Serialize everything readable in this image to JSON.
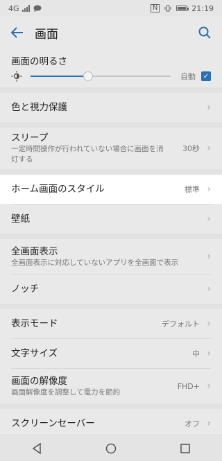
{
  "status_bar": {
    "network": "4G",
    "time": "21:19"
  },
  "app_bar": {
    "title": "画面"
  },
  "brightness": {
    "title": "画面の明るさ",
    "level": 0.41,
    "auto_label": "自動",
    "auto_checked": true
  },
  "items": [
    {
      "title": "色と視力保護",
      "sub": "",
      "value": ""
    },
    {
      "title": "スリープ",
      "sub": "一定時間操作が行われていない場合に画面を消灯する",
      "value": "30秒"
    },
    {
      "title": "ホーム画面のスタイル",
      "sub": "",
      "value": "標準"
    },
    {
      "title": "壁紙",
      "sub": "",
      "value": ""
    },
    {
      "title": "全画面表示",
      "sub": "全画面表示に対応していないアプリを全画面で表示",
      "value": ""
    },
    {
      "title": "ノッチ",
      "sub": "",
      "value": ""
    },
    {
      "title": "表示モード",
      "sub": "",
      "value": "デフォルト"
    },
    {
      "title": "文字サイズ",
      "sub": "",
      "value": "中"
    },
    {
      "title": "画面の解像度",
      "sub": "画面解像度を調整して電力を節約",
      "value": "FHD+"
    },
    {
      "title": "スクリーンセーバー",
      "sub": "",
      "value": "オフ"
    }
  ],
  "colors": {
    "accent": "#2a6fb0",
    "background": "#e9e9e9",
    "highlight": "#ffffff"
  }
}
